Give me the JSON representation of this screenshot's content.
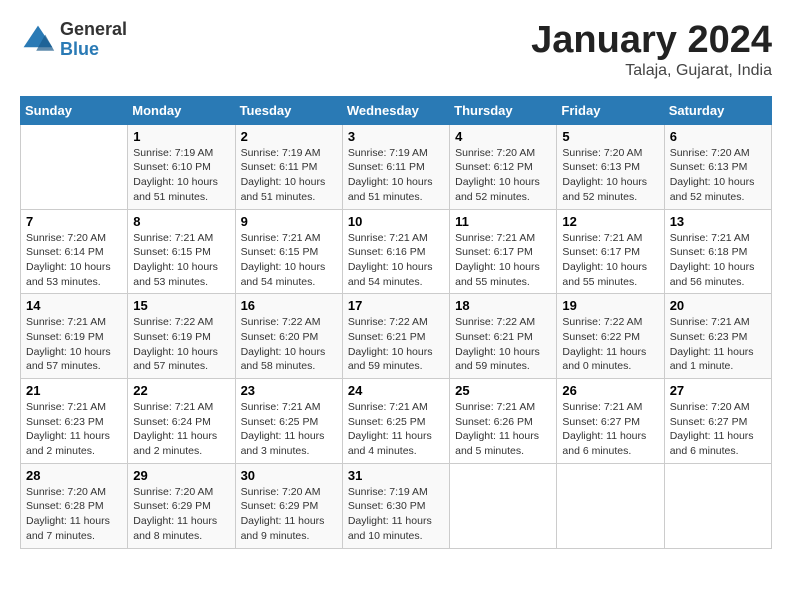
{
  "header": {
    "logo_general": "General",
    "logo_blue": "Blue",
    "title": "January 2024",
    "location": "Talaja, Gujarat, India"
  },
  "days_of_week": [
    "Sunday",
    "Monday",
    "Tuesday",
    "Wednesday",
    "Thursday",
    "Friday",
    "Saturday"
  ],
  "weeks": [
    [
      {
        "day": "",
        "info": ""
      },
      {
        "day": "1",
        "info": "Sunrise: 7:19 AM\nSunset: 6:10 PM\nDaylight: 10 hours and 51 minutes."
      },
      {
        "day": "2",
        "info": "Sunrise: 7:19 AM\nSunset: 6:11 PM\nDaylight: 10 hours and 51 minutes."
      },
      {
        "day": "3",
        "info": "Sunrise: 7:19 AM\nSunset: 6:11 PM\nDaylight: 10 hours and 51 minutes."
      },
      {
        "day": "4",
        "info": "Sunrise: 7:20 AM\nSunset: 6:12 PM\nDaylight: 10 hours and 52 minutes."
      },
      {
        "day": "5",
        "info": "Sunrise: 7:20 AM\nSunset: 6:13 PM\nDaylight: 10 hours and 52 minutes."
      },
      {
        "day": "6",
        "info": "Sunrise: 7:20 AM\nSunset: 6:13 PM\nDaylight: 10 hours and 52 minutes."
      }
    ],
    [
      {
        "day": "7",
        "info": "Sunrise: 7:20 AM\nSunset: 6:14 PM\nDaylight: 10 hours and 53 minutes."
      },
      {
        "day": "8",
        "info": "Sunrise: 7:21 AM\nSunset: 6:15 PM\nDaylight: 10 hours and 53 minutes."
      },
      {
        "day": "9",
        "info": "Sunrise: 7:21 AM\nSunset: 6:15 PM\nDaylight: 10 hours and 54 minutes."
      },
      {
        "day": "10",
        "info": "Sunrise: 7:21 AM\nSunset: 6:16 PM\nDaylight: 10 hours and 54 minutes."
      },
      {
        "day": "11",
        "info": "Sunrise: 7:21 AM\nSunset: 6:17 PM\nDaylight: 10 hours and 55 minutes."
      },
      {
        "day": "12",
        "info": "Sunrise: 7:21 AM\nSunset: 6:17 PM\nDaylight: 10 hours and 55 minutes."
      },
      {
        "day": "13",
        "info": "Sunrise: 7:21 AM\nSunset: 6:18 PM\nDaylight: 10 hours and 56 minutes."
      }
    ],
    [
      {
        "day": "14",
        "info": "Sunrise: 7:21 AM\nSunset: 6:19 PM\nDaylight: 10 hours and 57 minutes."
      },
      {
        "day": "15",
        "info": "Sunrise: 7:22 AM\nSunset: 6:19 PM\nDaylight: 10 hours and 57 minutes."
      },
      {
        "day": "16",
        "info": "Sunrise: 7:22 AM\nSunset: 6:20 PM\nDaylight: 10 hours and 58 minutes."
      },
      {
        "day": "17",
        "info": "Sunrise: 7:22 AM\nSunset: 6:21 PM\nDaylight: 10 hours and 59 minutes."
      },
      {
        "day": "18",
        "info": "Sunrise: 7:22 AM\nSunset: 6:21 PM\nDaylight: 10 hours and 59 minutes."
      },
      {
        "day": "19",
        "info": "Sunrise: 7:22 AM\nSunset: 6:22 PM\nDaylight: 11 hours and 0 minutes."
      },
      {
        "day": "20",
        "info": "Sunrise: 7:21 AM\nSunset: 6:23 PM\nDaylight: 11 hours and 1 minute."
      }
    ],
    [
      {
        "day": "21",
        "info": "Sunrise: 7:21 AM\nSunset: 6:23 PM\nDaylight: 11 hours and 2 minutes."
      },
      {
        "day": "22",
        "info": "Sunrise: 7:21 AM\nSunset: 6:24 PM\nDaylight: 11 hours and 2 minutes."
      },
      {
        "day": "23",
        "info": "Sunrise: 7:21 AM\nSunset: 6:25 PM\nDaylight: 11 hours and 3 minutes."
      },
      {
        "day": "24",
        "info": "Sunrise: 7:21 AM\nSunset: 6:25 PM\nDaylight: 11 hours and 4 minutes."
      },
      {
        "day": "25",
        "info": "Sunrise: 7:21 AM\nSunset: 6:26 PM\nDaylight: 11 hours and 5 minutes."
      },
      {
        "day": "26",
        "info": "Sunrise: 7:21 AM\nSunset: 6:27 PM\nDaylight: 11 hours and 6 minutes."
      },
      {
        "day": "27",
        "info": "Sunrise: 7:20 AM\nSunset: 6:27 PM\nDaylight: 11 hours and 6 minutes."
      }
    ],
    [
      {
        "day": "28",
        "info": "Sunrise: 7:20 AM\nSunset: 6:28 PM\nDaylight: 11 hours and 7 minutes."
      },
      {
        "day": "29",
        "info": "Sunrise: 7:20 AM\nSunset: 6:29 PM\nDaylight: 11 hours and 8 minutes."
      },
      {
        "day": "30",
        "info": "Sunrise: 7:20 AM\nSunset: 6:29 PM\nDaylight: 11 hours and 9 minutes."
      },
      {
        "day": "31",
        "info": "Sunrise: 7:19 AM\nSunset: 6:30 PM\nDaylight: 11 hours and 10 minutes."
      },
      {
        "day": "",
        "info": ""
      },
      {
        "day": "",
        "info": ""
      },
      {
        "day": "",
        "info": ""
      }
    ]
  ]
}
